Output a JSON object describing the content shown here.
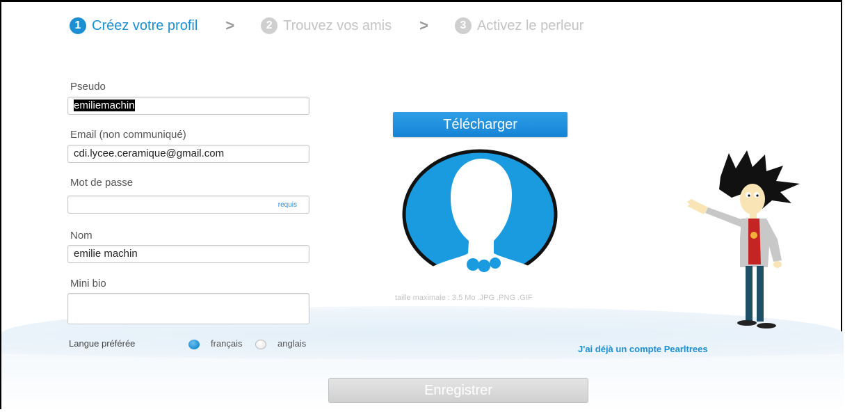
{
  "steps": [
    {
      "num": "1",
      "label": "Créez votre profil"
    },
    {
      "num": "2",
      "label": "Trouvez vos amis"
    },
    {
      "num": "3",
      "label": "Activez le perleur"
    }
  ],
  "form": {
    "pseudo_label": "Pseudo",
    "pseudo_value": "emiliemachin",
    "email_label": "Email (non communiqué)",
    "email_value": "cdi.lycee.ceramique@gmail.com",
    "password_label": "Mot de passe",
    "password_value": "",
    "password_required": "requis",
    "name_label": "Nom",
    "name_value": "emilie machin",
    "bio_label": "Mini bio",
    "bio_value": "",
    "language_label": "Langue préférée",
    "language_options": [
      "français",
      "anglais"
    ],
    "language_selected": "français"
  },
  "upload": {
    "button_label": "Télécharger",
    "size_note": "taille maximale : 3.5 Mo .JPG .PNG .GIF"
  },
  "account_link": "J'ai déjà un compte Pearltrees",
  "save_button": "Enregistrer",
  "colors": {
    "accent": "#1b8fd1",
    "inactive": "#c3c3c3"
  }
}
